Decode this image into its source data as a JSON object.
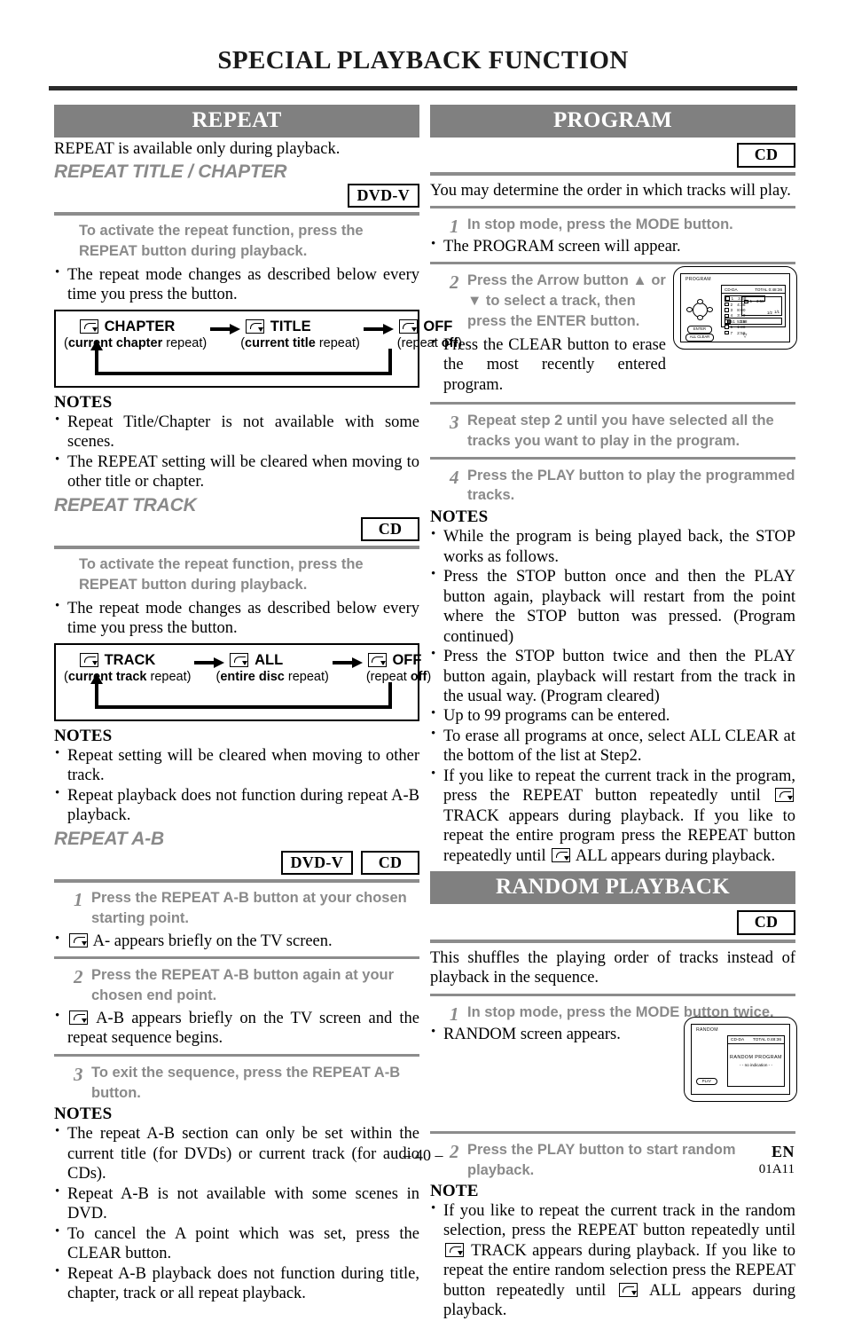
{
  "page": {
    "title": "SPECIAL PLAYBACK FUNCTION",
    "page_number": "– 40 –",
    "lang_code": "EN",
    "doc_code": "01A11"
  },
  "left_column": {
    "repeat": {
      "band": "REPEAT",
      "intro": "REPEAT is available only during playback.",
      "title_chapter": {
        "heading": "REPEAT TITLE / CHAPTER",
        "badges": [
          "DVD-V"
        ],
        "instruction": "To activate the repeat function, press the REPEAT button during playback.",
        "bullet": "The repeat mode changes as described below every time you press the button.",
        "flow": [
          {
            "label": "CHAPTER",
            "sub_bold": "current chapter",
            "sub_rest": " repeat)",
            "sub_open": "("
          },
          {
            "label": "TITLE",
            "sub_bold": "current title",
            "sub_rest": " repeat)",
            "sub_open": "("
          },
          {
            "label": "OFF",
            "sub_bold": "off",
            "sub_rest": ")",
            "sub_open": "(repeat "
          }
        ],
        "notes_heading": "NOTES",
        "notes": [
          "Repeat Title/Chapter is not available with some scenes.",
          "The REPEAT setting will be cleared when moving to other title or chapter."
        ]
      },
      "track": {
        "heading": "REPEAT TRACK",
        "badges": [
          "CD"
        ],
        "instruction": "To activate the repeat function, press the REPEAT button during playback.",
        "bullet": "The repeat mode changes as described below every time you press the button.",
        "flow": [
          {
            "label": "TRACK",
            "sub_bold": "current track",
            "sub_rest": " repeat)",
            "sub_open": "("
          },
          {
            "label": "ALL",
            "sub_bold": "entire disc",
            "sub_rest": " repeat)",
            "sub_open": "("
          },
          {
            "label": "OFF",
            "sub_bold": "off",
            "sub_rest": ")",
            "sub_open": "(repeat "
          }
        ],
        "notes_heading": "NOTES",
        "notes": [
          "Repeat setting will be cleared when moving to other track.",
          "Repeat playback does not function during repeat A-B playback."
        ]
      },
      "ab": {
        "heading": "REPEAT A-B",
        "badges": [
          "DVD-V",
          "CD"
        ],
        "steps": [
          {
            "num": "1",
            "text": "Press the REPEAT A-B button at your chosen starting point.",
            "bullet_pre": "",
            "bullet_post": "A- appears briefly on the TV screen."
          },
          {
            "num": "2",
            "text": "Press the REPEAT A-B button again at your chosen end point.",
            "bullet_pre": "",
            "bullet_post": "A-B appears briefly on the TV screen and the repeat sequence begins."
          },
          {
            "num": "3",
            "text": "To exit the sequence, press the REPEAT A-B button."
          }
        ],
        "notes_heading": "NOTES",
        "notes": [
          "The repeat A-B section can only be set within the current title (for DVDs) or current track (for audio CDs).",
          "Repeat A-B is not available with some scenes in DVD.",
          "To cancel the A point which was set, press the CLEAR button.",
          "Repeat A-B playback does not function during title, chapter, track or all repeat playback."
        ]
      }
    }
  },
  "right_column": {
    "program": {
      "band": "PROGRAM",
      "badges": [
        "CD"
      ],
      "intro": "You may determine the order in which tracks will play.",
      "steps": [
        {
          "num": "1",
          "text": "In stop mode, press the MODE button.",
          "bullet": "The PROGRAM screen will appear."
        },
        {
          "num": "2",
          "text": "Press the Arrow button ▲ or ▼ to select a track, then press the ENTER button.",
          "bullet": "Press the CLEAR button to erase the most recently entered program."
        },
        {
          "num": "3",
          "text": "Repeat step 2 until you have selected all the tracks you want to play in the program."
        },
        {
          "num": "4",
          "text": "Press the PLAY button to play the programmed tracks."
        }
      ],
      "osd": {
        "label": "PROGRAM",
        "disc_type": "CD-DA",
        "total": "TOTAL 0:48:36",
        "tracks": [
          {
            "no": "1",
            "time": "3:58"
          },
          {
            "no": "2",
            "time": "4:38"
          },
          {
            "no": "3",
            "time": "8:00"
          },
          {
            "no": "4",
            "time": "3:18"
          },
          {
            "no": "5",
            "time": "5:18"
          },
          {
            "no": "6",
            "time": "1:38"
          },
          {
            "no": "7",
            "time": "2:58"
          }
        ],
        "list_page": "1/2",
        "entry_page": "1/1",
        "entries": [
          {
            "no": "1",
            "time": "3:58"
          }
        ],
        "bottom_entry": {
          "no": "1",
          "time": "3:58"
        },
        "buttons": [
          "ENTER",
          "ALL CLEAR"
        ]
      },
      "notes_heading": "NOTES",
      "notes_plain": [
        "While the program is being played back, the STOP works as follows.",
        "Press the STOP button once and then the PLAY button again, playback will restart from the point where the STOP button was pressed. (Program continued)",
        "Press the STOP button twice and then the PLAY button again, playback will restart from the track in the usual way. (Program cleared)",
        "Up to 99 programs can be entered.",
        "To erase all programs at once, select ALL CLEAR at the bottom of the list at Step2."
      ],
      "note_repeat": {
        "part1": "If you like to repeat the current track in the program, press the REPEAT button repeatedly until",
        "part2": "TRACK appears during playback. If you like to repeat the entire program press the REPEAT button repeatedly until",
        "part3": "ALL appears during playback."
      }
    },
    "random": {
      "band": "RANDOM PLAYBACK",
      "badges": [
        "CD"
      ],
      "intro": "This shuffles the playing order of tracks instead of playback in the sequence.",
      "steps": [
        {
          "num": "1",
          "text": "In stop mode, press the MODE button twice.",
          "bullet": "RANDOM screen appears."
        },
        {
          "num": "2",
          "text": "Press the PLAY button to start random playback."
        }
      ],
      "osd": {
        "label": "RANDOM",
        "disc_type": "CD-DA",
        "total": "TOTAL 0:48:36",
        "line1": "RANDOM PROGRAM",
        "line2": "- - no indication - -",
        "button": "PLAY"
      },
      "note_heading": "NOTE",
      "note_repeat": {
        "part1": "If you like to repeat the current track in the random selection, press the REPEAT button repeatedly until",
        "part2": "TRACK appears during playback. If you like to repeat the entire random selection press the REPEAT button repeatedly until",
        "part3": "ALL appears during playback."
      }
    }
  }
}
